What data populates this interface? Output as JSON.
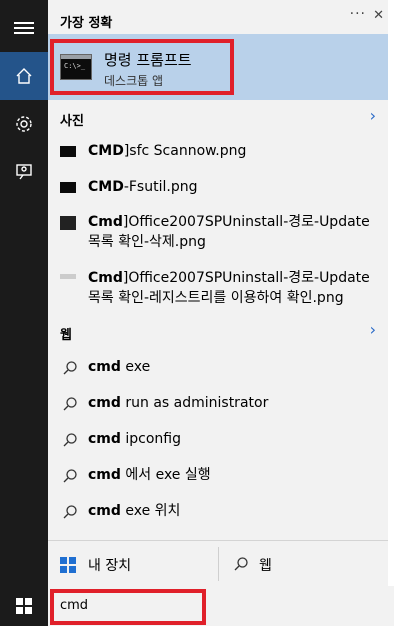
{
  "rail": {
    "icons": [
      "hamburger-menu-icon",
      "home-icon",
      "settings-gear-icon",
      "feedback-person-icon"
    ]
  },
  "header": {
    "best_match": "가장 정확",
    "more": "···",
    "close": "✕"
  },
  "best_match": {
    "title": "명령 프롬프트",
    "subtitle": "데스크톱 앱",
    "icon_text": "C:\\>_"
  },
  "photos": {
    "heading": "사진",
    "items": [
      {
        "bold": "CMD",
        "rest": "]sfc Scannow.png",
        "line2": ""
      },
      {
        "bold": "CMD",
        "rest": "-Fsutil.png",
        "line2": ""
      },
      {
        "bold": "Cmd",
        "rest": "]Office2007SPUninstall-경로-Update",
        "line2": "목록 확인-삭제.png"
      },
      {
        "bold": "Cmd",
        "rest": "]Office2007SPUninstall-경로-Update",
        "line2": "목록 확인-레지스트리를 이용하여 확인.png"
      }
    ]
  },
  "web": {
    "heading": "웹",
    "items": [
      {
        "bold": "cmd",
        "rest": " exe"
      },
      {
        "bold": "cmd",
        "rest": " run as administrator"
      },
      {
        "bold": "cmd",
        "rest": " ipconfig"
      },
      {
        "bold": "cmd",
        "rest": " 에서 exe 실행"
      },
      {
        "bold": "cmd",
        "rest": " exe 위치"
      }
    ]
  },
  "bottom": {
    "my_stuff": "내 장치",
    "web": "웹"
  },
  "search": {
    "value": "cmd"
  },
  "colors": {
    "accent": "#24548a",
    "highlight": "#b9d1ea",
    "outline": "#e0202a"
  }
}
